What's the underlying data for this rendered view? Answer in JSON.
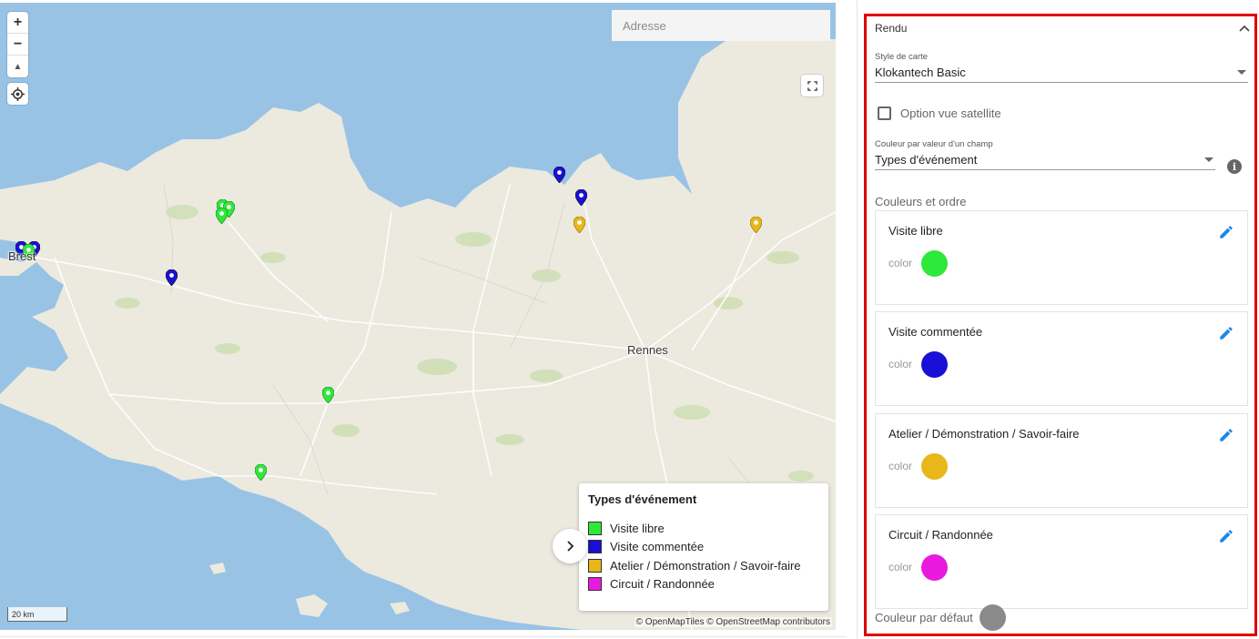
{
  "map": {
    "address_placeholder": "Adresse",
    "zoom_in_label": "+",
    "zoom_out_label": "−",
    "compass_label": "▲",
    "cities": [
      {
        "name": "Brest"
      },
      {
        "name": "Rennes"
      }
    ],
    "scale_label": "20 km",
    "attribution": "© OpenMapTiles © OpenStreetMap contributors",
    "land_color": "#ece9df",
    "water_color": "#98c3e5"
  },
  "legend": {
    "toggle_icon": "chevron-right",
    "title": "Types d'événement",
    "items": [
      {
        "label": "Visite libre",
        "color": "#2ee83a"
      },
      {
        "label": "Visite commentée",
        "color": "#1a0fd6"
      },
      {
        "label": "Atelier / Démonstration / Savoir-faire",
        "color": "#e8b71a"
      },
      {
        "label": "Circuit / Randonnée",
        "color": "#e81ae0"
      }
    ]
  },
  "panel": {
    "section_title": "Rendu",
    "collapse_icon": "chevron-up",
    "map_style": {
      "label": "Style de carte",
      "value": "Klokantech Basic"
    },
    "satellite_option": {
      "label": "Option vue satellite",
      "checked": false
    },
    "color_by_field": {
      "label": "Couleur par valeur d'un champ",
      "value": "Types d'événement",
      "info_icon": "info-icon"
    },
    "colors_section_label": "Couleurs et ordre",
    "color_cards": [
      {
        "name": "Visite libre",
        "color_label": "color",
        "color": "#2ee83a"
      },
      {
        "name": "Visite commentée",
        "color_label": "color",
        "color": "#1a0fd6"
      },
      {
        "name": "Atelier / Démonstration / Savoir-faire",
        "color_label": "color",
        "color": "#e8b71a"
      },
      {
        "name": "Circuit / Randonnée",
        "color_label": "color",
        "color": "#e81ae0"
      }
    ],
    "default_color": {
      "label": "Couleur par défaut",
      "color": "#8a8a8a"
    },
    "highlight_border_color": "#e00000",
    "edit_icon_color": "#1e88e5"
  }
}
